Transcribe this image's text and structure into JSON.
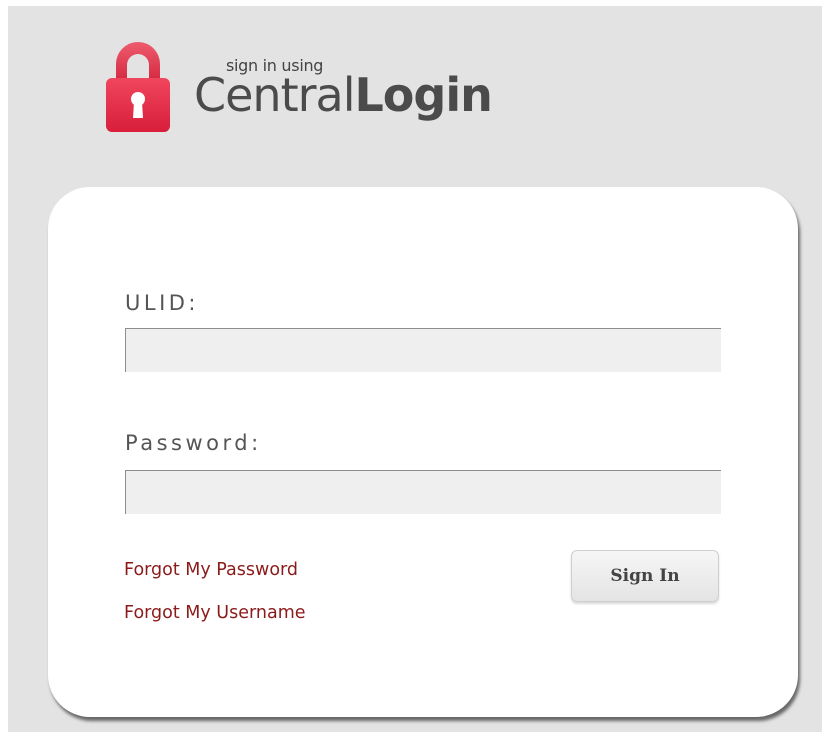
{
  "logo": {
    "small_text": "sign in using",
    "main_text_light": "Central",
    "main_text_bold": "Login",
    "icon": "lock-icon",
    "icon_color": "#e8304a"
  },
  "form": {
    "ulid_label": "ULID:",
    "ulid_value": "",
    "password_label": "Password:",
    "password_value": ""
  },
  "links": {
    "forgot_password": "Forgot My Password",
    "forgot_username": "Forgot My Username"
  },
  "button": {
    "signin_label": "Sign In"
  },
  "colors": {
    "background": "#e3e3e3",
    "card": "#ffffff",
    "link": "#8b1a1a",
    "input_bg": "#efefef"
  }
}
